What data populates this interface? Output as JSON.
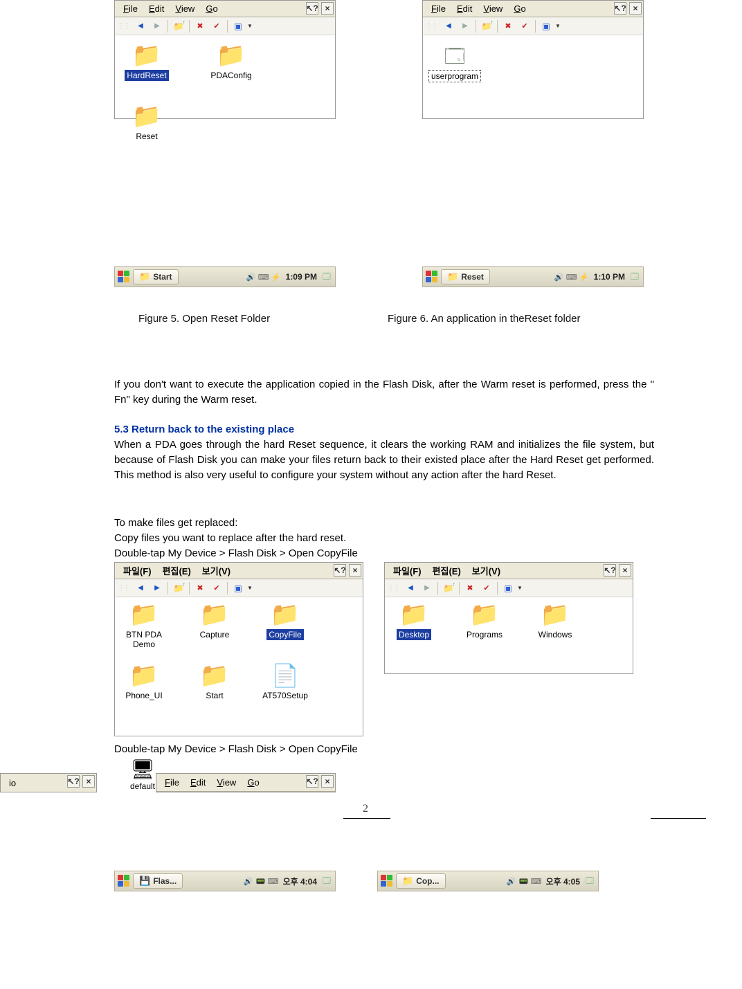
{
  "menus_en": {
    "file": "File",
    "edit": "Edit",
    "view": "View",
    "go": "Go"
  },
  "menus_kr": {
    "file": "파일(F)",
    "edit": "편집(E)",
    "view": "보기(V)"
  },
  "help_q": "?",
  "close_x": "×",
  "win5": {
    "items": [
      {
        "label": "HardReset",
        "icon": "closed dark",
        "sel": true
      },
      {
        "label": "PDAConfig",
        "icon": "closed"
      },
      {
        "label": "Reset",
        "icon": "closed"
      }
    ]
  },
  "win6": {
    "items": [
      {
        "label": "userprogram",
        "icon": "prog",
        "boxed": true
      }
    ]
  },
  "taskbar5": {
    "btn": "Start",
    "icon": "fico",
    "time": "1:09 PM"
  },
  "taskbar6": {
    "btn": "Reset",
    "icon": "fico",
    "time": "1:10 PM"
  },
  "caption5": "Figure 5. Open Reset Folder",
  "caption6": "Figure 6. An application in theReset folder",
  "para1": "If you don't want to execute the application copied in the Flash Disk, after the Warm reset is performed, press the \" Fn\"  key during the Warm reset.",
  "sec53": "5.3 Return back to the existing place",
  "para2": "When a PDA goes through the hard Reset sequence, it clears the working RAM and initializes the file system, but because of Flash Disk you can make your files return back to their existed place after the Hard Reset get performed. This method is also very useful to configure your system without any action after the hard Reset.",
  "para3a": "To make files get replaced:",
  "para3b": "Copy files you want to replace after the hard reset.",
  "step1": "Double-tap My Device > Flash Disk > Open CopyFile",
  "winA": {
    "items": [
      {
        "label": "BTN PDA Demo",
        "icon": "closed"
      },
      {
        "label": "Capture",
        "icon": "closed"
      },
      {
        "label": "CopyFile",
        "icon": "closed dark",
        "sel": true
      },
      {
        "label": "Phone_UI",
        "icon": "closed"
      },
      {
        "label": "Start",
        "icon": "closed"
      },
      {
        "label": "AT570Setup",
        "icon": "doc"
      }
    ]
  },
  "winB": {
    "items": [
      {
        "label": "Desktop",
        "icon": "closed dark",
        "sel": true
      },
      {
        "label": "Programs",
        "icon": "closed"
      },
      {
        "label": "Windows",
        "icon": "closed"
      }
    ]
  },
  "step2": "Double-tap My Device > Flash Disk > Open CopyFile",
  "mini_default": "default",
  "frag_go": "io",
  "page_num": "2",
  "taskbarC": {
    "btn": "Flas...",
    "icon": "hd",
    "time": "오후 4:04"
  },
  "taskbarD": {
    "btn": "Cop...",
    "icon": "fico",
    "time": "오후 4:05"
  }
}
